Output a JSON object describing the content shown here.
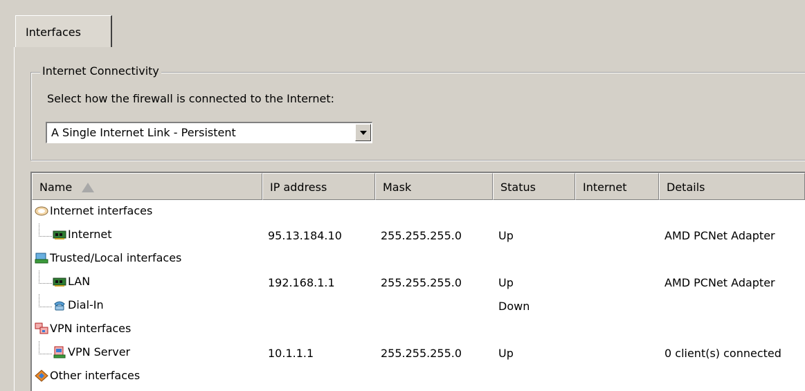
{
  "tabs": [
    {
      "label": "Interfaces"
    }
  ],
  "connectivity": {
    "group_title": "Internet Connectivity",
    "prompt": "Select how the firewall is connected to the Internet:",
    "selected_mode": "A Single Internet Link - Persistent"
  },
  "table": {
    "columns": [
      "Name",
      "IP address",
      "Mask",
      "Status",
      "Internet",
      "Details"
    ],
    "groups": [
      {
        "label": "Internet interfaces",
        "icon": "cloud-icon",
        "items": [
          {
            "name": "Internet",
            "icon": "network-card-icon",
            "ip": "95.13.184.10",
            "mask": "255.255.255.0",
            "status": "Up",
            "internet": "",
            "details": "AMD PCNet Adapter"
          }
        ]
      },
      {
        "label": "Trusted/Local interfaces",
        "icon": "local-network-icon",
        "items": [
          {
            "name": "LAN",
            "icon": "network-card-icon",
            "ip": "192.168.1.1",
            "mask": "255.255.255.0",
            "status": "Up",
            "internet": "",
            "details": "AMD PCNet Adapter"
          },
          {
            "name": "Dial-In",
            "icon": "dial-up-icon",
            "ip": "",
            "mask": "",
            "status": "Down",
            "internet": "",
            "details": ""
          }
        ]
      },
      {
        "label": "VPN interfaces",
        "icon": "vpn-interfaces-icon",
        "items": [
          {
            "name": "VPN Server",
            "icon": "vpn-server-icon",
            "ip": "10.1.1.1",
            "mask": "255.255.255.0",
            "status": "Up",
            "internet": "",
            "details": "0 client(s) connected"
          }
        ]
      },
      {
        "label": "Other interfaces",
        "icon": "other-interfaces-icon",
        "items": []
      }
    ]
  }
}
